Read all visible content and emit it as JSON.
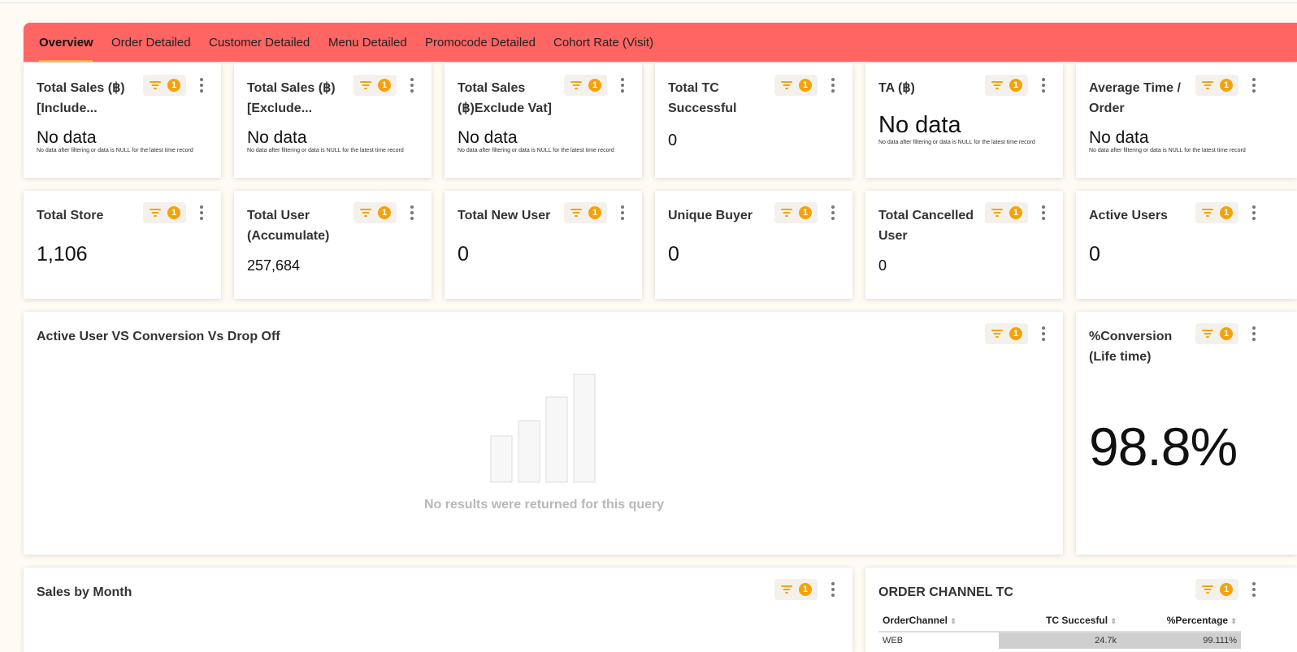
{
  "tabs": [
    {
      "label": "Overview",
      "active": true
    },
    {
      "label": "Order Detailed"
    },
    {
      "label": "Customer Detailed"
    },
    {
      "label": "Menu Detailed"
    },
    {
      "label": "Promocode Detailed"
    },
    {
      "label": "Cohort Rate (Visit)"
    }
  ],
  "filter_count": "1",
  "note": "No data after filtering or data is NULL for the latest time record",
  "row1": [
    {
      "title_line1": "Total Sales (฿)",
      "title_line2": "[Include...",
      "value": "No data"
    },
    {
      "title_line1": "Total Sales (฿)",
      "title_line2": "[Exclude...",
      "value": "No data"
    },
    {
      "title_line1": "Total Sales",
      "title_line2": "(฿)Exclude Vat]",
      "value": "No data"
    },
    {
      "title_line1": "Total TC",
      "title_line2": "Successful",
      "value": "0"
    },
    {
      "title_line1": "TA (฿)",
      "title_line2": "",
      "value": "No data"
    },
    {
      "title_line1": "Average Time /",
      "title_line2": "Order",
      "value": "No data"
    }
  ],
  "row2": [
    {
      "title_line1": "Total Store",
      "title_line2": "",
      "value": "1,106"
    },
    {
      "title_line1": "Total User",
      "title_line2": "(Accumulate)",
      "value": "257,684"
    },
    {
      "title_line1": "Total New User",
      "title_line2": "",
      "value": "0"
    },
    {
      "title_line1": "Unique Buyer",
      "title_line2": "",
      "value": "0"
    },
    {
      "title_line1": "Total Cancelled",
      "title_line2": "User",
      "value": "0"
    },
    {
      "title_line1": "Active Users",
      "title_line2": "",
      "value": "0"
    }
  ],
  "active_chart": {
    "title": "Active User VS Conversion Vs Drop Off",
    "empty_message": "No results were returned for this query"
  },
  "conversion": {
    "title_line1": "%Conversion",
    "title_line2": "(Life time)",
    "value": "98.8%"
  },
  "sales_by_month": {
    "title": "Sales by Month"
  },
  "order_channel": {
    "title": "ORDER CHANNEL TC",
    "columns": [
      "OrderChannel",
      "TC Succesful",
      "%Percentage"
    ],
    "first_row": [
      "WEB",
      "24.7k",
      "99.111%"
    ]
  },
  "colors": {
    "tab_bar": "#ff6563",
    "badge": "#f5a20a",
    "background": "#fffaf3"
  }
}
